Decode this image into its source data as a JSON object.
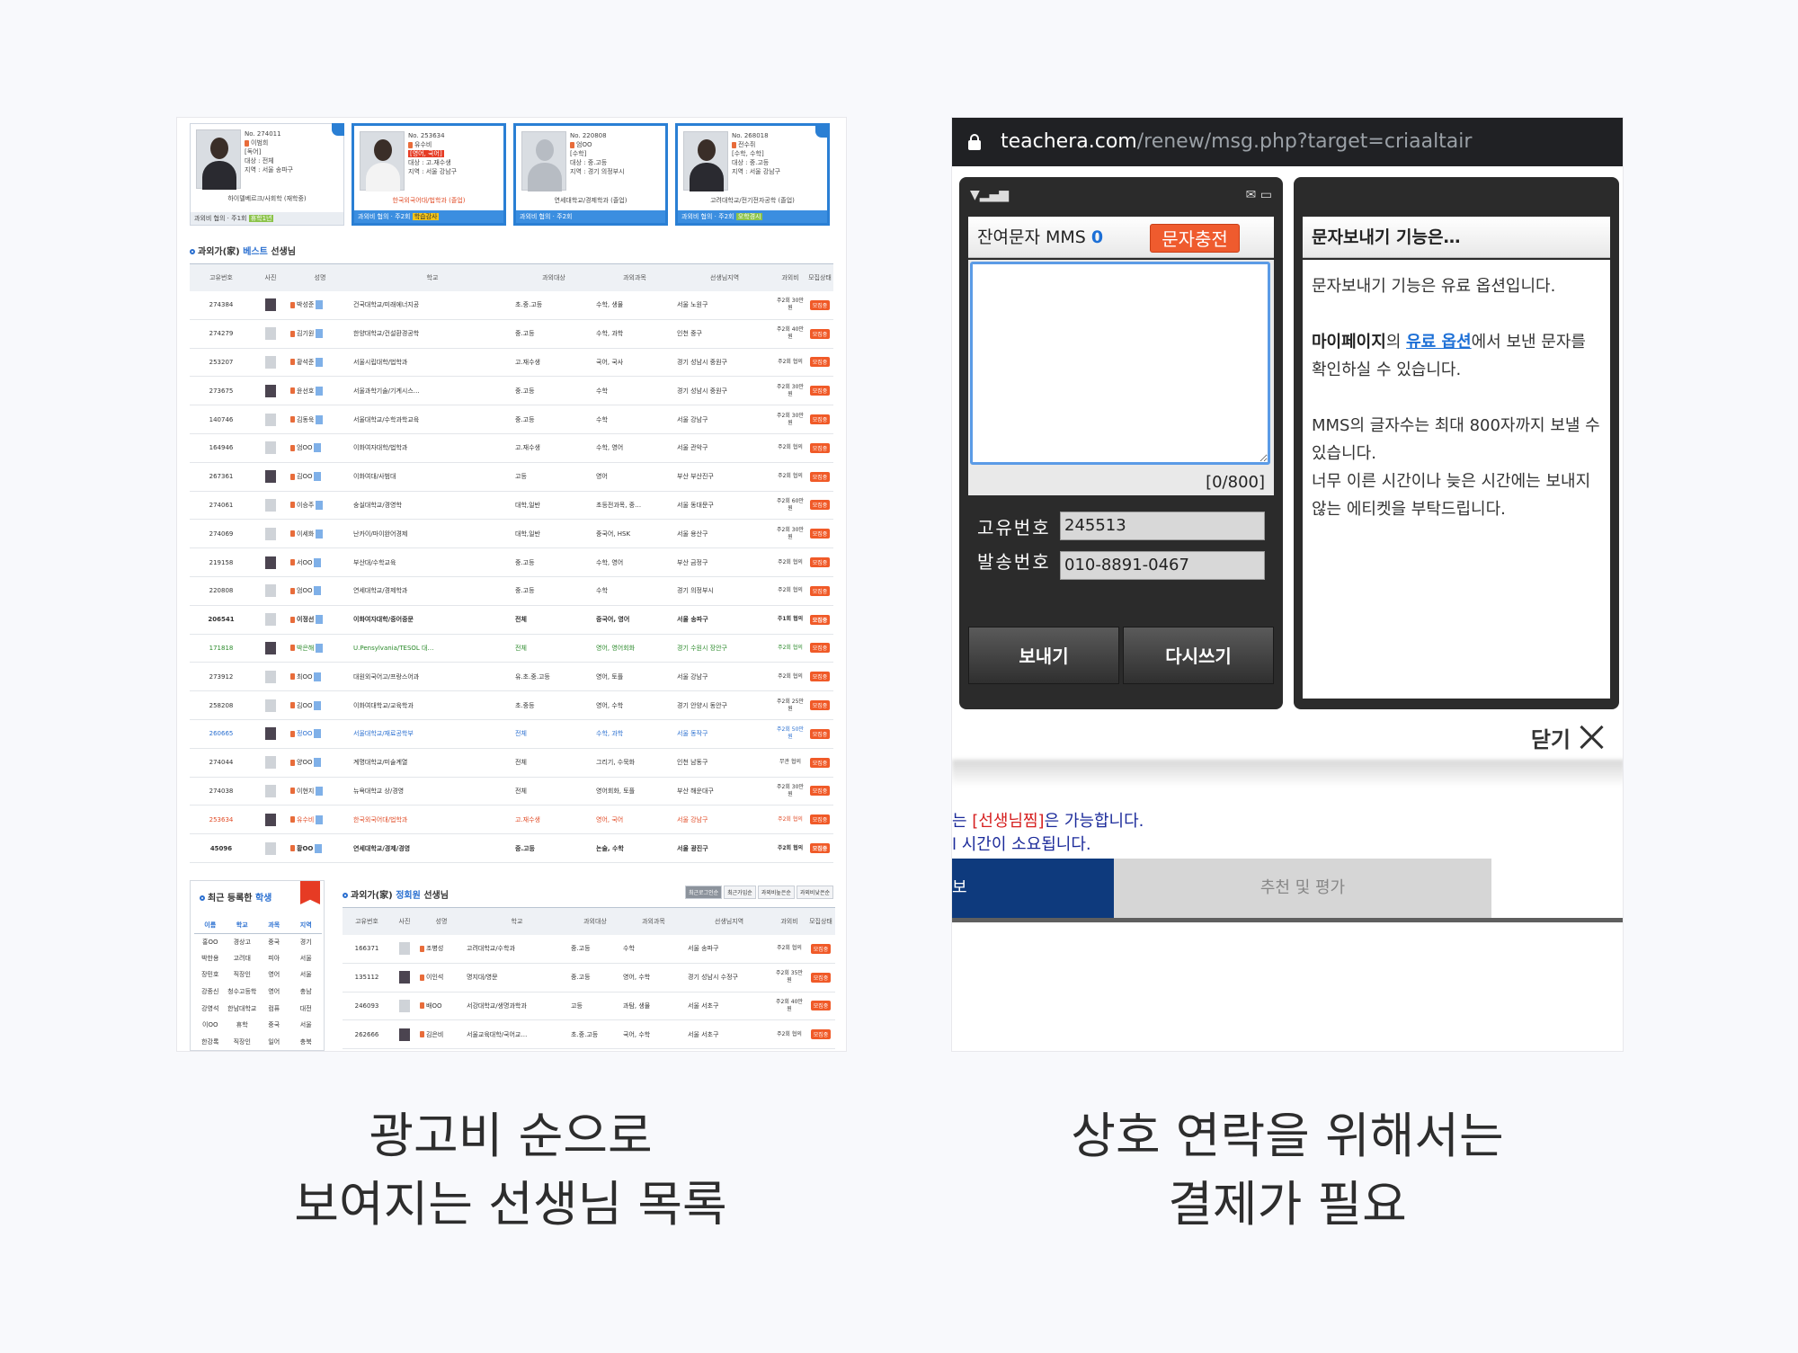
{
  "captions": {
    "left_line1": "광고비 순으로",
    "left_line2": "보여지는 선생님 목록",
    "right_line1": "상호 연락을 위해서는",
    "right_line2": "결제가 필요"
  },
  "cards": [
    {
      "no": "No. 274011",
      "name": "이범희",
      "subject": "[독어]",
      "target": "대상 : 전체",
      "area": "지역 : 서울 송파구",
      "school": "하이델베르크/사회학 (재학중)",
      "fee": "협의",
      "freq": "주1회",
      "extra": "휴학1년"
    },
    {
      "no": "No. 253634",
      "name": "유수비",
      "subject": "[영어, 국어]",
      "target": "대상 : 고.재수생",
      "area": "지역 : 서울 강남구",
      "school": "한국외국어대/법학과 (졸업)",
      "fee": "협의",
      "freq": "주2회",
      "extra": "학습감사"
    },
    {
      "no": "No. 220808",
      "name": "엄OO",
      "subject": "[수학]",
      "target": "대상 : 중.고등",
      "area": "지역 : 경기 의정부시",
      "school": "연세대학교/경제학과 (졸업)",
      "fee": "협의",
      "freq": "주2회",
      "extra": ""
    },
    {
      "no": "No. 268018",
      "name": "전수쥐",
      "subject": "[수학, 수학]",
      "target": "대상 : 중.고등",
      "area": "지역 : 서울 강남구",
      "school": "고려대학교/전기전자공학 (졸업)",
      "fee": "협의",
      "freq": "주2회",
      "extra": "오학경시"
    }
  ],
  "best": {
    "title_prefix": "과외가(家)",
    "title_highlight": "베스트",
    "title_suffix": "선생님",
    "headers": [
      "고유번호",
      "사진",
      "성명",
      "학교",
      "과외대상",
      "과외과목",
      "선생님지역",
      "과외비",
      "모집상태"
    ],
    "rows": [
      {
        "id": "274384",
        "name": "박성준",
        "school": "건국대학교/미래에너지공",
        "target": "초.중.고등",
        "subject": "수학, 생물",
        "area": "서울 노원구",
        "fee": "주2회 30만원",
        "status": "모집중",
        "style": ""
      },
      {
        "id": "274279",
        "name": "김기원",
        "school": "한양대학교/건설환경공학",
        "target": "중.고등",
        "subject": "수학, 과학",
        "area": "인천 중구",
        "fee": "주2회 40만원",
        "status": "모집중",
        "style": ""
      },
      {
        "id": "253207",
        "name": "황석준",
        "school": "서울시립대학/법학과",
        "target": "고.재수생",
        "subject": "국어, 국사",
        "area": "경기 성남시 중원구",
        "fee": "주2회 협의",
        "status": "모집중",
        "style": ""
      },
      {
        "id": "273675",
        "name": "윤선호",
        "school": "서울과학기술/기계시스…",
        "target": "중.고등",
        "subject": "수학",
        "area": "경기 성남시 중원구",
        "fee": "주2회 30만원",
        "status": "모집중",
        "style": ""
      },
      {
        "id": "140746",
        "name": "김동욱",
        "school": "서울대학교/수학과학교육",
        "target": "중.고등",
        "subject": "수학",
        "area": "서울 강남구",
        "fee": "주2회 30만원",
        "status": "모집중",
        "style": ""
      },
      {
        "id": "164946",
        "name": "엄OO",
        "school": "이화여자대학/법학과",
        "target": "고.재수생",
        "subject": "수학, 영어",
        "area": "서울 관악구",
        "fee": "주2회 협의",
        "status": "모집중",
        "style": ""
      },
      {
        "id": "267361",
        "name": "김OO",
        "school": "이화여대/사범대",
        "target": "고등",
        "subject": "영어",
        "area": "부산 부산진구",
        "fee": "주2회 협의",
        "status": "모집중",
        "style": ""
      },
      {
        "id": "274061",
        "name": "이승주",
        "school": "숭실대학교/경영학",
        "target": "대학,일반",
        "subject": "초등전과목, 중…",
        "area": "서울 동대문구",
        "fee": "주2회 60만원",
        "status": "모집중",
        "style": ""
      },
      {
        "id": "274069",
        "name": "이세화",
        "school": "난카이/마이완어경제",
        "target": "대학,일반",
        "subject": "중국어, HSK",
        "area": "서울 용산구",
        "fee": "주2회 30만원",
        "status": "모집중",
        "style": ""
      },
      {
        "id": "219158",
        "name": "서OO",
        "school": "부산대/수학교육",
        "target": "중.고등",
        "subject": "수학, 영어",
        "area": "부산 금정구",
        "fee": "주2회 협의",
        "status": "모집중",
        "style": ""
      },
      {
        "id": "220808",
        "name": "엄OO",
        "school": "연세대학교/경제학과",
        "target": "중.고등",
        "subject": "수학",
        "area": "경기 의정부시",
        "fee": "주2회 협의",
        "status": "모집중",
        "style": ""
      },
      {
        "id": "206541",
        "name": "이정선",
        "school": "이화여자대학/중어중문",
        "target": "전체",
        "subject": "중국어, 영어",
        "area": "서울 송파구",
        "fee": "주1회 협의",
        "status": "모집중",
        "style": "bold"
      },
      {
        "id": "171818",
        "name": "박은해",
        "school": "U.Pensylvania/TESOL 대…",
        "target": "전체",
        "subject": "영어, 영어회화",
        "area": "경기 수원시 장안구",
        "fee": "주2회 협의",
        "status": "모집중",
        "style": "green"
      },
      {
        "id": "273912",
        "name": "최OO",
        "school": "대원외국어고/프랑스어과",
        "target": "유.초.중.고등",
        "subject": "영어, 토플",
        "area": "서울 강남구",
        "fee": "주2회 협의",
        "status": "모집중",
        "style": ""
      },
      {
        "id": "258208",
        "name": "김OO",
        "school": "이화여대학교/교육학과",
        "target": "초.중등",
        "subject": "영어, 수학",
        "area": "경기 안양시 동안구",
        "fee": "주2회 25만원",
        "status": "모집중",
        "style": ""
      },
      {
        "id": "260665",
        "name": "정OO",
        "school": "서울대학교/재료공학부",
        "target": "전체",
        "subject": "수학, 과학",
        "area": "서울 동작구",
        "fee": "주2회 50만원",
        "status": "모집중",
        "style": "blue"
      },
      {
        "id": "274044",
        "name": "양OO",
        "school": "계명대학교/미술계열",
        "target": "전체",
        "subject": "그리기, 수묵화",
        "area": "인천 남동구",
        "fee": "무관 협의",
        "status": "모집중",
        "style": ""
      },
      {
        "id": "274038",
        "name": "이현지",
        "school": "뉴욕대학교 상/경영",
        "target": "전체",
        "subject": "영어회화, 토플",
        "area": "부산 해운대구",
        "fee": "주2회 30만원",
        "status": "모집중",
        "style": ""
      },
      {
        "id": "253634",
        "name": "유수비",
        "school": "한국외국어대/법학과",
        "target": "고.재수생",
        "subject": "영어, 국어",
        "area": "서울 강남구",
        "fee": "주2회 협의",
        "status": "모집중",
        "style": "red"
      },
      {
        "id": "45096",
        "name": "황OO",
        "school": "연세대학교/경제/경영",
        "target": "중.고등",
        "subject": "논술, 수학",
        "area": "서울 광진구",
        "fee": "주2회 협의",
        "status": "모집중",
        "style": "bold"
      }
    ]
  },
  "recent_students": {
    "title_prefix": "최근 등록한",
    "title_highlight": "학생",
    "headers": [
      "이름",
      "학교",
      "과목",
      "지역"
    ],
    "rows": [
      [
        "홍OO",
        "경상고",
        "중국",
        "경기"
      ],
      [
        "박한용",
        "고려대",
        "피아",
        "서울"
      ],
      [
        "장민호",
        "직장인",
        "영어",
        "서울"
      ],
      [
        "강종신",
        "청수고등학",
        "영어",
        "충남"
      ],
      [
        "강영석",
        "한남대학교",
        "컴퓨",
        "대전"
      ],
      [
        "이OO",
        "휴학",
        "중국",
        "서울"
      ],
      [
        "한강록",
        "직장인",
        "일어",
        "충북"
      ]
    ]
  },
  "regular": {
    "title_prefix": "과외가(家)",
    "title_highlight": "정회원",
    "title_suffix": "선생님",
    "sort_buttons": [
      "최근로그인순",
      "최근가입순",
      "과외비높은순",
      "과외비낮은순"
    ],
    "headers": [
      "고유번호",
      "사진",
      "성명",
      "학교",
      "과외대상",
      "과외과목",
      "선생님지역",
      "과외비",
      "모집상태"
    ],
    "rows": [
      {
        "id": "166371",
        "name": "조병성",
        "school": "고려대학교/수학과",
        "target": "중.고등",
        "subject": "수학",
        "area": "서울 송파구",
        "fee": "주2회 협의",
        "status": "모집중"
      },
      {
        "id": "135112",
        "name": "이인석",
        "school": "명지대/영문",
        "target": "중.고등",
        "subject": "영어, 수학",
        "area": "경기 성남시 수정구",
        "fee": "주2회 35만원",
        "status": "모집중"
      },
      {
        "id": "246093",
        "name": "배OO",
        "school": "서강대학교/생명과학과",
        "target": "고등",
        "subject": "과탐, 생물",
        "area": "서울 서초구",
        "fee": "주2회 40만원",
        "status": "모집중"
      },
      {
        "id": "262666",
        "name": "김은비",
        "school": "서울교육대학/국어교…",
        "target": "초.중.고등",
        "subject": "국어, 수학",
        "area": "서울 서초구",
        "fee": "주2회 협의",
        "status": "모집중"
      }
    ]
  },
  "browser": {
    "host": "teachera.com",
    "path": "/renew/msg.php?target=criaaltair"
  },
  "phone": {
    "remain_label": "잔여문자 MMS",
    "remain_count": "0",
    "charge_button": "문자충전",
    "counter": "[0/800]",
    "id_label": "고유번호",
    "id_value": "245513",
    "sender_label": "발송번호",
    "sender_value": "010-8891-0467",
    "send_button": "보내기",
    "rewrite_button": "다시쓰기"
  },
  "help": {
    "title": "문자보내기 기능은…",
    "p1": "문자보내기 기능은 유료 옵션입니다.",
    "p2_bold": "마이페이지",
    "p2_mid": "의 ",
    "p2_link": "유료 옵션",
    "p2_rest": "에서 보낸 문자를 확인하실 수 있습니다.",
    "p3": "MMS의 글자수는 최대 800자까지 보낼 수 있습니다.",
    "p4": "너무 이른 시간이나 늦은 시간에는 보내지 않는 에티켓을 부탁드립니다."
  },
  "close": {
    "label": "닫기"
  },
  "background_page": {
    "notice1_pre": "는 ",
    "notice1_red": "[선생님찜]",
    "notice1_post": "은 가능합니다.",
    "notice2": "l 시간이 소요됩니다.",
    "tab_dark": "보",
    "tab_light": "추천 및 평가"
  }
}
